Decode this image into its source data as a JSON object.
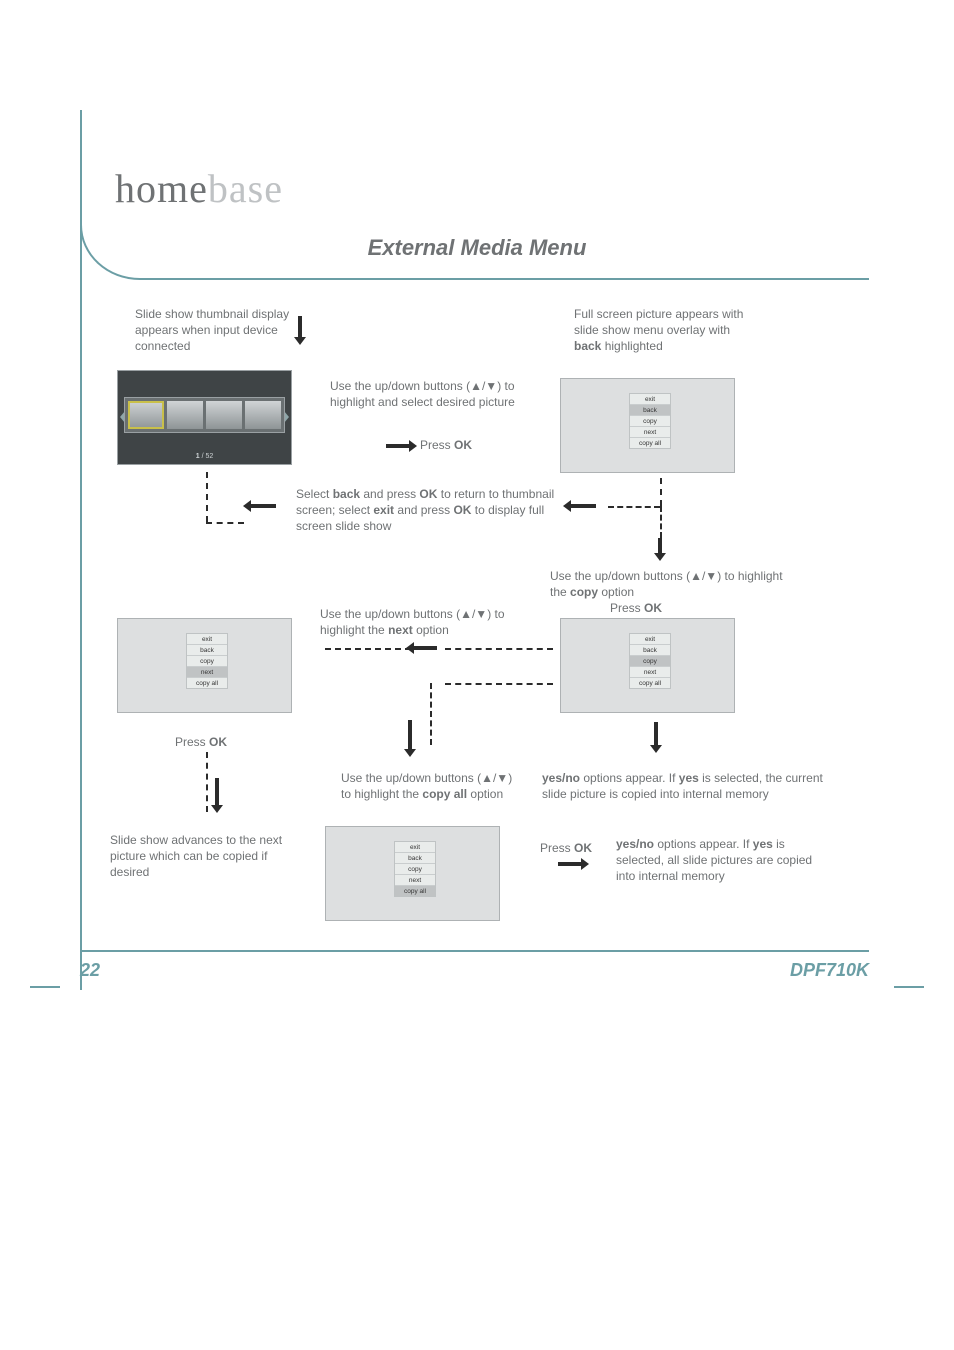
{
  "brand": {
    "a": "home",
    "b": "base"
  },
  "page_title": "External Media Menu",
  "captions": {
    "c1": "Slide show thumbnail display appears when input device connected",
    "c2a": "Use the up/down buttons (",
    "c2b": ") to highlight and select desired picture",
    "c3": "Press ",
    "ok": "OK",
    "c4a": "Select ",
    "c4b": " and press ",
    "c4c": " to return to thumbnail screen; select ",
    "c4d": " and press ",
    "c4e": " to display full screen slide show",
    "c5a": "Full screen picture appears with slide show menu overlay with ",
    "c5b": " highlighted",
    "c6a": "Use the up/down buttons (",
    "c6b": ") to highlight the ",
    "c6c": " option",
    "c7a": "Use the up/down buttons (",
    "c7b": ") to highlight the ",
    "c7c": " option",
    "c8a": "Use the up/down buttons (",
    "c8b": ") to highlight the ",
    "c8c": " option",
    "c9": "Slide show advances to the next picture which can be copied if desired",
    "c10a": "yes/no",
    "c10b": " options appear. If ",
    "c10c": "yes",
    "c10d": " is selected, the current slide picture is copied into internal memory",
    "c11a": "yes/no",
    "c11b": " options appear. If ",
    "c11c": "yes",
    "c11d": " is selected, all slide pictures are copied into internal memory",
    "words": {
      "back": "back",
      "exit": "exit",
      "copy": "copy",
      "next": "next",
      "copy_all": "copy all"
    },
    "arrows": "▲/▼"
  },
  "menu": {
    "items": [
      "exit",
      "back",
      "copy",
      "next",
      "copy all"
    ]
  },
  "pager": {
    "current": "1",
    "sep": " / ",
    "total": "52"
  },
  "footer": {
    "page": "22",
    "model": "DPF710K"
  }
}
